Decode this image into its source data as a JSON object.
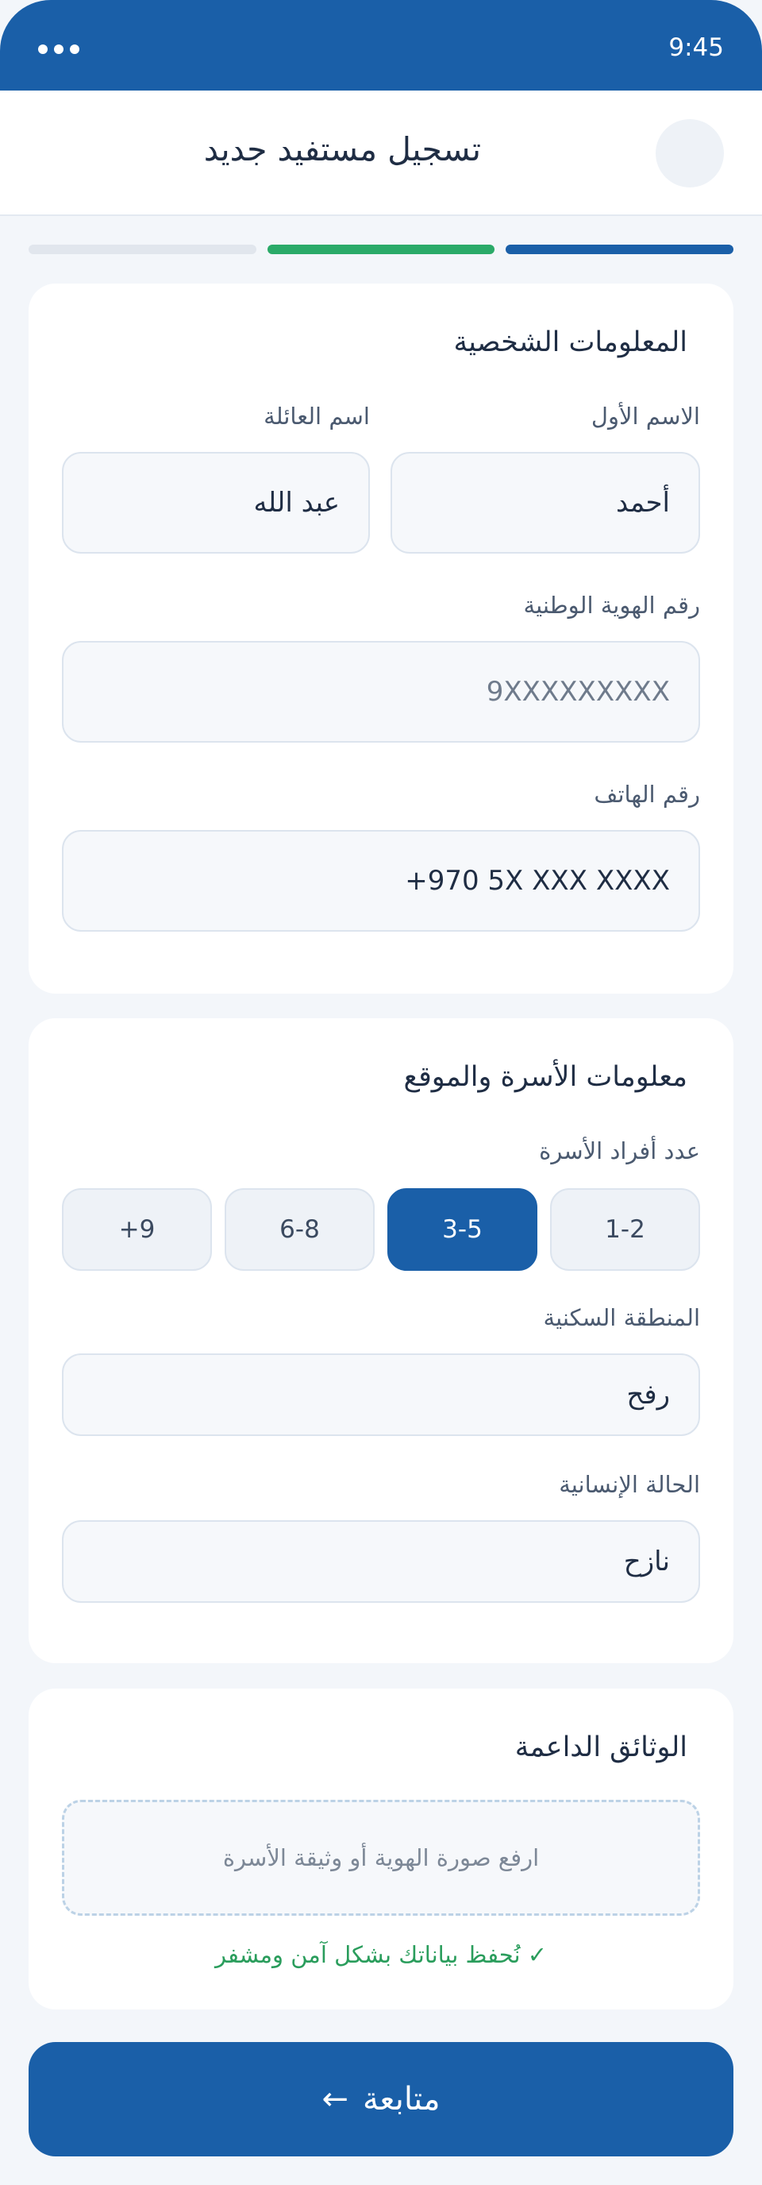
{
  "status": {
    "time": "9:45"
  },
  "header": {
    "title": "تسجيل مستفيد جديد"
  },
  "colors": {
    "primary": "#1a5fa8",
    "success": "#2aaa68",
    "inactive": "#e1e6ed"
  },
  "progress": {
    "steps": [
      "done",
      "current",
      "pending"
    ]
  },
  "personal": {
    "title": "المعلومات الشخصية",
    "first_name_label": "الاسم الأول",
    "first_name_value": "أحمد",
    "family_name_label": "اسم العائلة",
    "family_name_value": "عبد الله",
    "national_id_label": "رقم الهوية الوطنية",
    "national_id_placeholder": "9XXXXXXXXX",
    "phone_label": "رقم الهاتف",
    "phone_placeholder": "+970 5X XXX XXXX"
  },
  "family": {
    "title": "معلومات الأسرة والموقع",
    "size_label": "عدد أفراد الأسرة",
    "size_options": [
      "1-2",
      "3-5",
      "6-8",
      "+9"
    ],
    "size_selected": "3-5",
    "area_label": "المنطقة السكنية",
    "area_value": "رفح",
    "status_label": "الحالة الإنسانية",
    "status_value": "نازح"
  },
  "documents": {
    "title": "الوثائق الداعمة",
    "upload_text": "ارفع صورة الهوية أو وثيقة الأسرة",
    "secure_text": "✓ نُحفظ بياناتك بشكل آمن ومشفر"
  },
  "actions": {
    "continue_label": "متابعة",
    "continue_arrow": "←"
  }
}
